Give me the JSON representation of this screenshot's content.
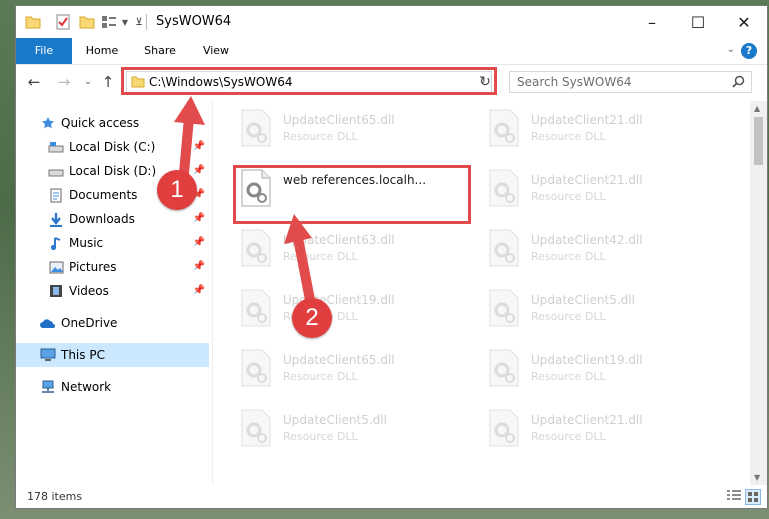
{
  "window": {
    "title": "SysWOW64",
    "controls": {
      "minimize": "–",
      "maximize": "☐",
      "close": "✕"
    }
  },
  "ribbon": {
    "tabs": [
      "File",
      "Home",
      "Share",
      "View"
    ],
    "help": "?"
  },
  "nav": {
    "address": "C:\\Windows\\SysWOW64",
    "search_placeholder": "Search SysWOW64"
  },
  "sidebar": {
    "items": [
      {
        "label": "Quick access",
        "icon": "star-icon"
      },
      {
        "label": "Local Disk (C:)",
        "icon": "drive-icon"
      },
      {
        "label": "Local Disk (D:)",
        "icon": "drive-icon"
      },
      {
        "label": "Documents",
        "icon": "documents-icon"
      },
      {
        "label": "Downloads",
        "icon": "download-icon"
      },
      {
        "label": "Music",
        "icon": "music-icon"
      },
      {
        "label": "Pictures",
        "icon": "pictures-icon"
      },
      {
        "label": "Videos",
        "icon": "videos-icon"
      },
      {
        "label": "OneDrive",
        "icon": "cloud-icon"
      },
      {
        "label": "This PC",
        "icon": "computer-icon"
      },
      {
        "label": "Network",
        "icon": "network-icon"
      }
    ]
  },
  "files": [
    {
      "name": "UpdateClient65.dll",
      "type": "Resource DLL"
    },
    {
      "name": "UpdateClient21.dll",
      "type": "Resource DLL"
    },
    {
      "name": "web references.localh...",
      "type": ""
    },
    {
      "name": "UpdateClient21.dll",
      "type": "Resource DLL"
    },
    {
      "name": "UpdateClient63.dll",
      "type": "Resource DLL"
    },
    {
      "name": "UpdateClient42.dll",
      "type": "Resource DLL"
    },
    {
      "name": "UpdateClient19.dll",
      "type": "Resource DLL"
    },
    {
      "name": "UpdateClient5.dll",
      "type": "Resource DLL"
    },
    {
      "name": "UpdateClient65.dll",
      "type": "Resource DLL"
    },
    {
      "name": "UpdateClient19.dll",
      "type": "Resource DLL"
    },
    {
      "name": "UpdateClient5.dll",
      "type": "Resource DLL"
    },
    {
      "name": "UpdateClient21.dll",
      "type": "Resource DLL"
    }
  ],
  "status": {
    "item_count": "178 items"
  },
  "annotations": {
    "step1": "1",
    "step2": "2"
  },
  "colors": {
    "accent": "#1979ca",
    "highlight": "#e24b4b",
    "selected_nav": "#cce8ff"
  }
}
